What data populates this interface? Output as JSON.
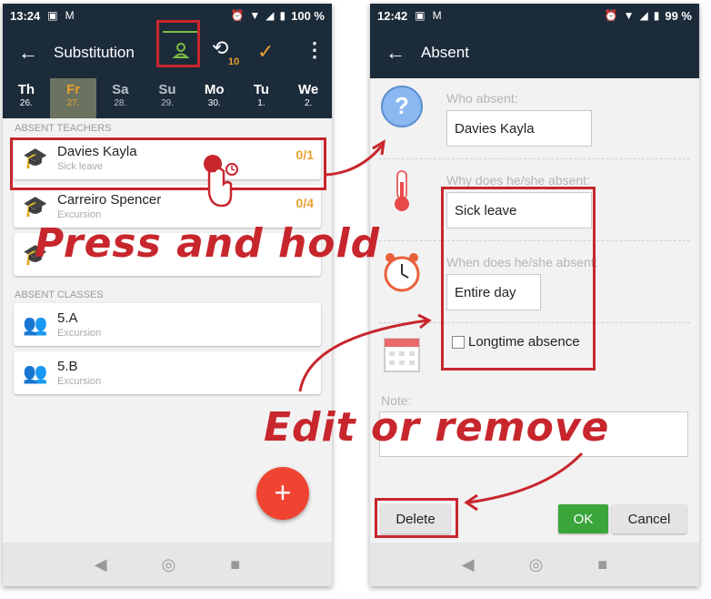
{
  "left": {
    "status": {
      "time": "13:24",
      "battery": "100 %"
    },
    "appbar": {
      "title": "Substitution",
      "history_badge": "10"
    },
    "days": [
      {
        "name": "Th",
        "date": "26."
      },
      {
        "name": "Fr",
        "date": "27."
      },
      {
        "name": "Sa",
        "date": "28."
      },
      {
        "name": "Su",
        "date": "29."
      },
      {
        "name": "Mo",
        "date": "30."
      },
      {
        "name": "Tu",
        "date": "1."
      },
      {
        "name": "We",
        "date": "2."
      }
    ],
    "teachers_header": "ABSENT TEACHERS",
    "teachers": [
      {
        "name": "Davies Kayla",
        "reason": "Sick leave",
        "count": "0/1"
      },
      {
        "name": "Carreiro Spencer",
        "reason": "Excursion",
        "count": "0/4"
      }
    ],
    "classes_header": "ABSENT CLASSES",
    "classes": [
      {
        "name": "5.A",
        "reason": "Excursion"
      },
      {
        "name": "5.B",
        "reason": "Excursion"
      }
    ],
    "fab_label": "+"
  },
  "right": {
    "status": {
      "time": "12:42",
      "battery": "99 %"
    },
    "appbar": {
      "title": "Absent"
    },
    "who_label": "Who absent:",
    "who_value": "Davies Kayla",
    "why_label": "Why does he/she absent:",
    "why_value": "Sick leave",
    "when_label": "When does he/she absent:",
    "when_value": "Entire day",
    "longtime_label": "Longtime absence",
    "note_label": "Note:",
    "note_value": "",
    "delete_label": "Delete",
    "ok_label": "OK",
    "cancel_label": "Cancel"
  },
  "annotations": {
    "press_hold": "Press and hold",
    "edit_remove": "Edit or remove"
  },
  "colors": {
    "appbar": "#1c2b3a",
    "accent_orange": "#e8a030",
    "highlight_red": "#c8262d",
    "fab": "#f04432",
    "ok_green": "#3aa53a"
  }
}
